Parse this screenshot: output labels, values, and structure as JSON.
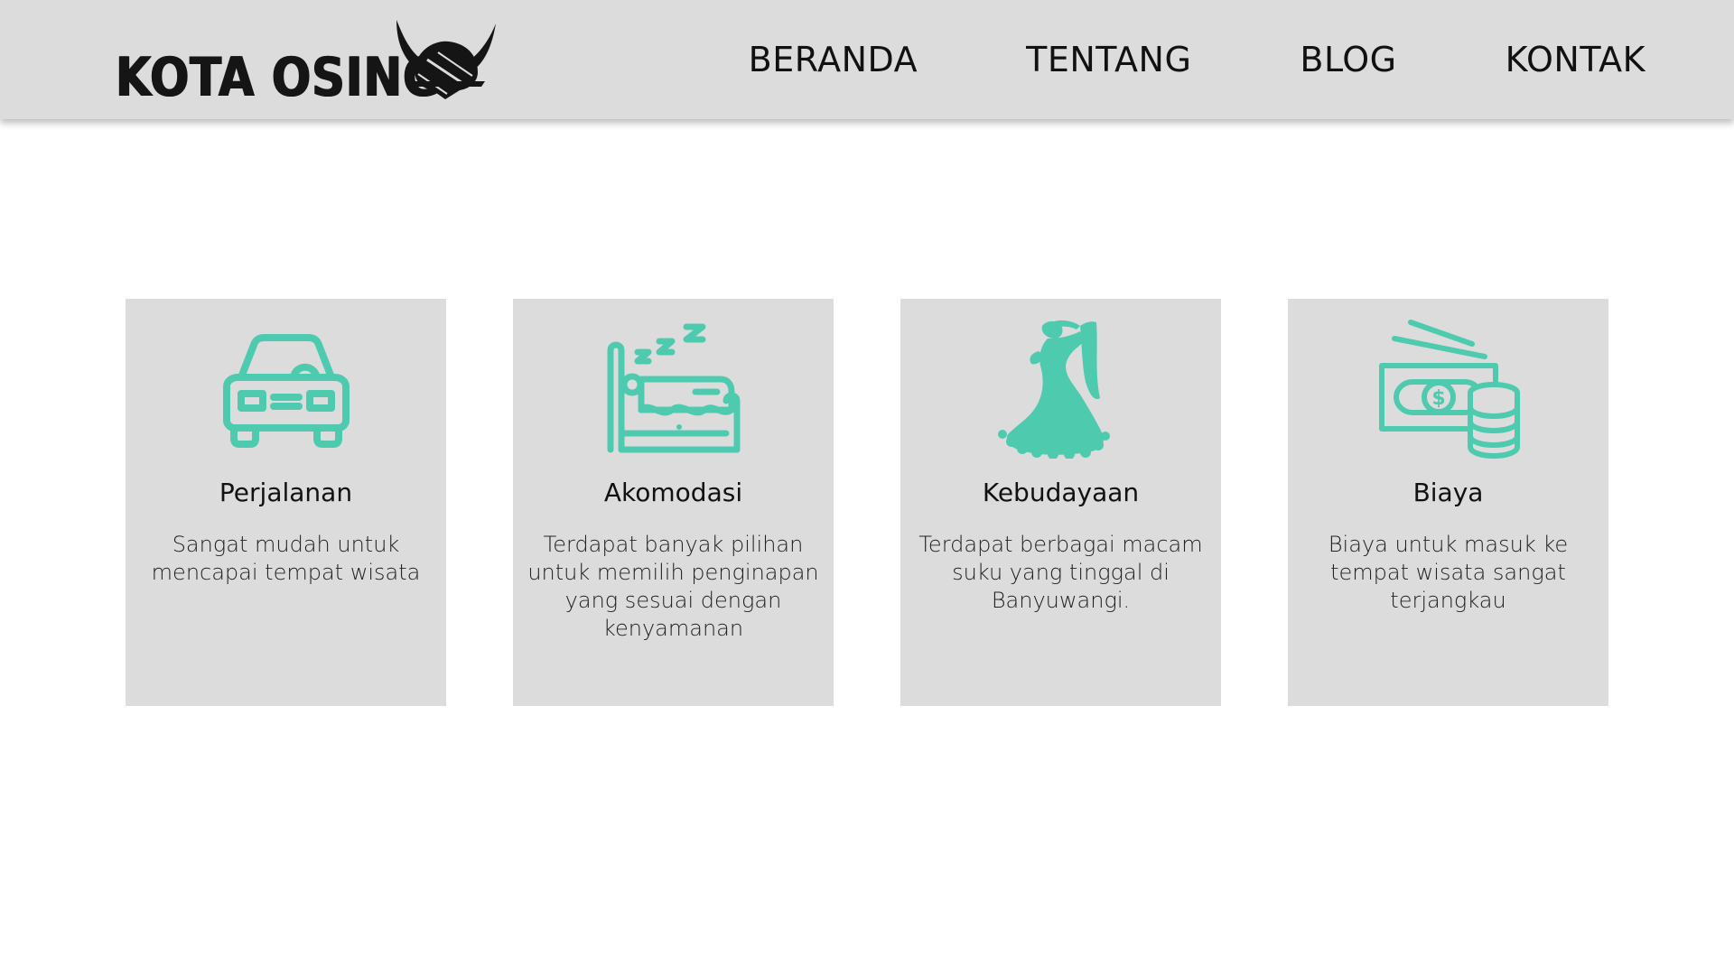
{
  "brand": {
    "name": "KOTA OSING",
    "accent_color": "#4ecbaf",
    "header_bg": "#dcdcdc"
  },
  "nav": {
    "items": [
      {
        "label": "BERANDA"
      },
      {
        "label": "TENTANG"
      },
      {
        "label": "BLOG"
      },
      {
        "label": "KONTAK"
      }
    ]
  },
  "features": [
    {
      "icon": "car-icon",
      "title": "Perjalanan",
      "description": "Sangat mudah untuk mencapai tempat wisata"
    },
    {
      "icon": "sleeping-bed-icon",
      "title": "Akomodasi",
      "description": "Terdapat banyak pilihan untuk memilih penginapan yang sesuai dengan kenyamanan"
    },
    {
      "icon": "dancer-icon",
      "title": "Kebudayaan",
      "description": "Terdapat berbagai macam suku yang tinggal di Banyuwangi."
    },
    {
      "icon": "money-coins-icon",
      "title": "Biaya",
      "description": "Biaya untuk masuk ke tempat wisata sangat terjangkau"
    }
  ]
}
